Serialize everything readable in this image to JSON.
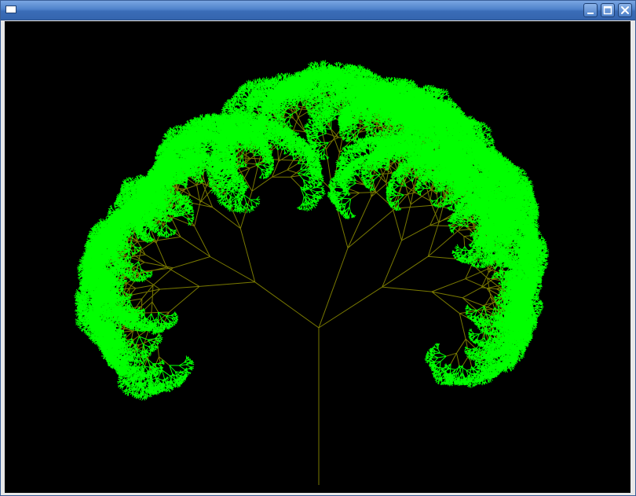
{
  "window": {
    "title": "",
    "icon": "window-icon",
    "buttons": [
      {
        "name": "minimize-button",
        "icon": "minimize-icon"
      },
      {
        "name": "maximize-button",
        "icon": "maximize-icon"
      },
      {
        "name": "close-button",
        "icon": "close-icon"
      }
    ]
  },
  "canvas": {
    "background": "#000000",
    "branch_color": "#7a7a00",
    "leaf_color": "#00ff00"
  }
}
